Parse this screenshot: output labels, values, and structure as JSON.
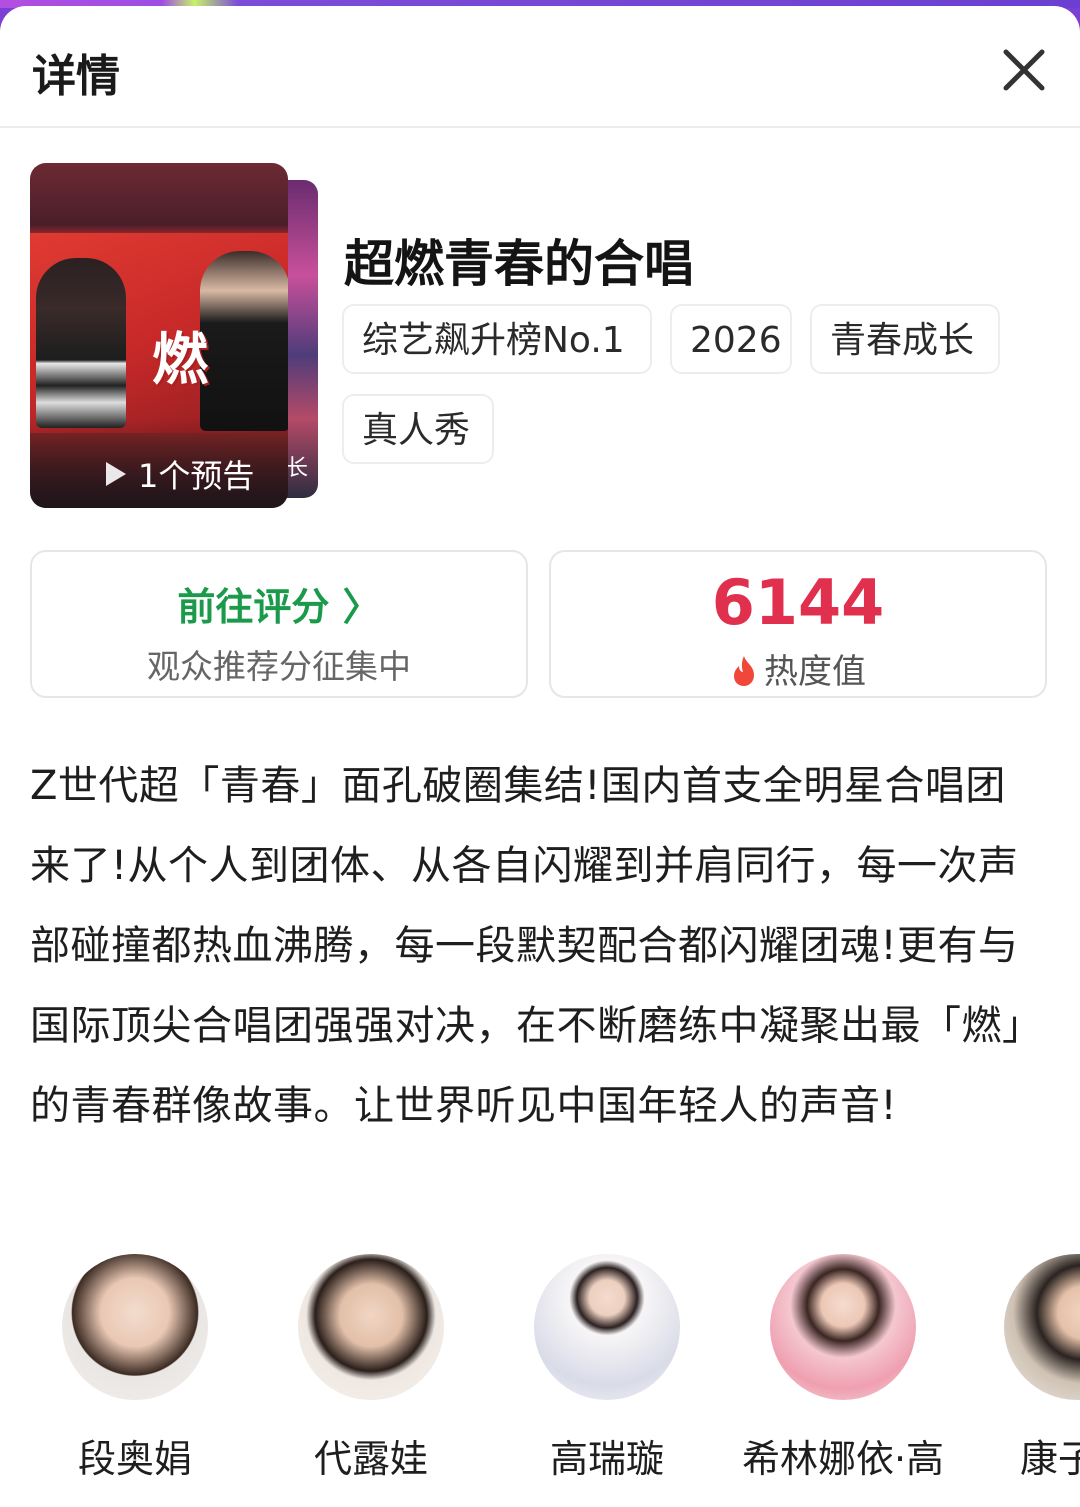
{
  "header": {
    "title": "详情"
  },
  "poster": {
    "trailer_label": "1个预告",
    "poster_text": "燃",
    "back_poster_text": "长"
  },
  "show": {
    "title": "超燃青春的合唱",
    "tags": [
      "综艺飙升榜No.1",
      "2026",
      "青春成长",
      "真人秀"
    ]
  },
  "rating": {
    "label": "前往评分 〉",
    "subtitle": "观众推荐分征集中"
  },
  "heat": {
    "value": "6144",
    "label": "热度值"
  },
  "description": "Z世代超「青春」面孔破圈集结!国内首支全明星合唱团来了!从个人到团体、从各自闪耀到并肩同行，每一次声部碰撞都热血沸腾，每一段默契配合都闪耀团魂!更有与国际顶尖合唱团强强对决，在不断磨练中凝聚出最「燃」的青春群像故事。让世界听见中国年轻人的声音!",
  "cast": [
    {
      "name": "段奥娟"
    },
    {
      "name": "代露娃"
    },
    {
      "name": "高瑞璇"
    },
    {
      "name": "希林娜依·高"
    },
    {
      "name": "康子"
    }
  ],
  "colors": {
    "accent_green": "#1a9a4a",
    "heat_red": "#e0304e",
    "top_bar": "#7b3fd6"
  },
  "icons": {
    "close": "close-icon",
    "play": "play-icon",
    "flame": "flame-icon",
    "chevron": "chevron-right-icon"
  }
}
